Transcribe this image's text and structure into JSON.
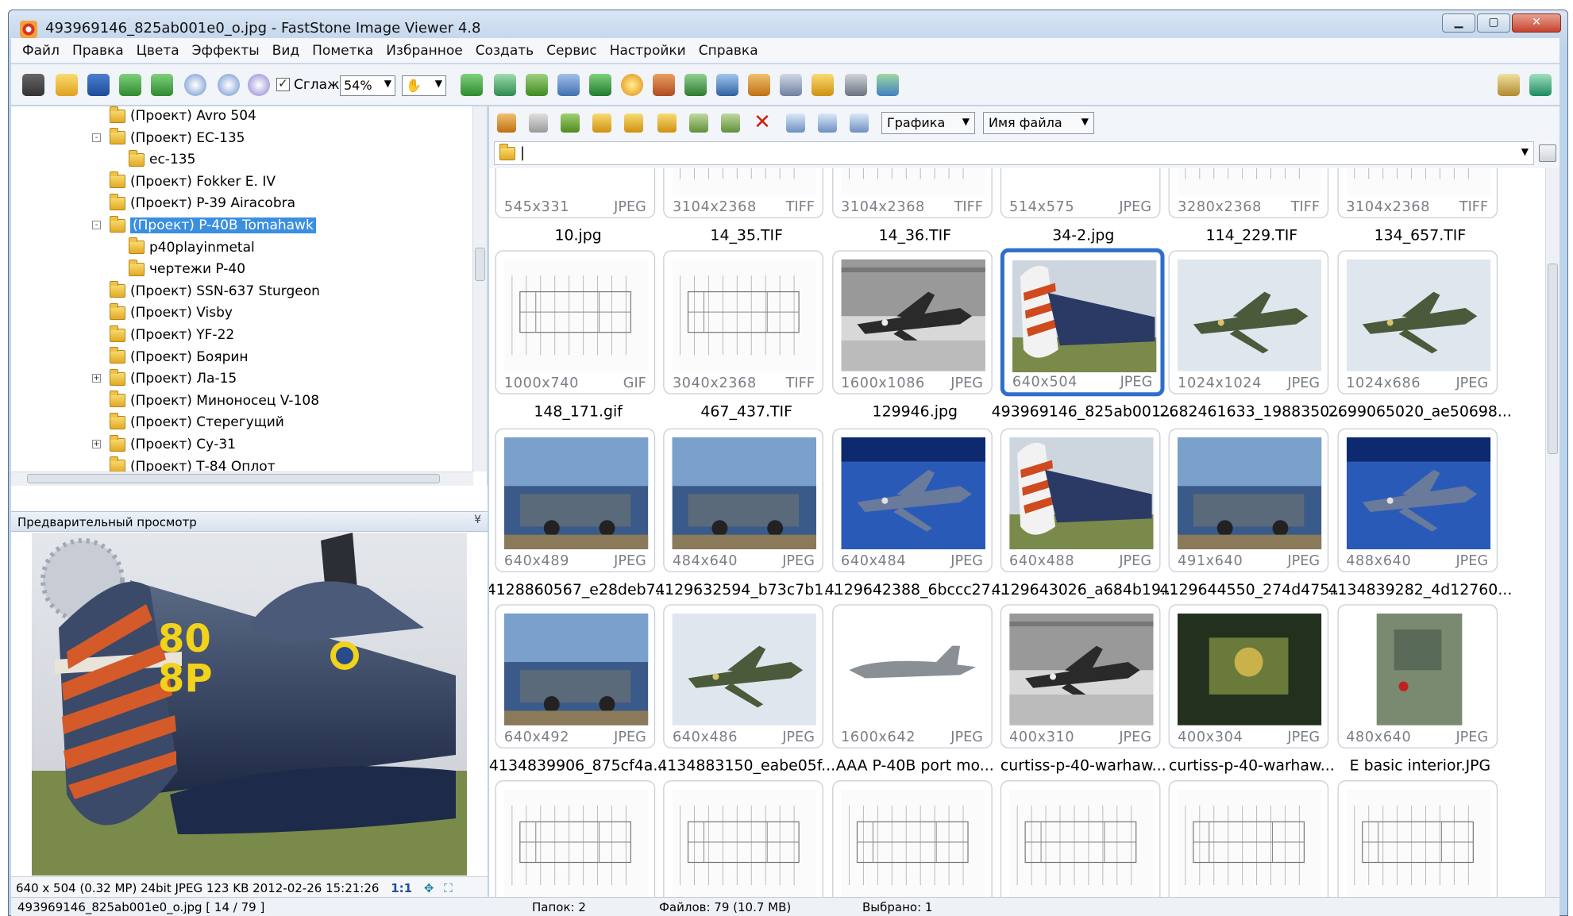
{
  "window": {
    "title": "493969146_825ab001e0_o.jpg  -  FastStone Image Viewer 4.8"
  },
  "menu": [
    "Файл",
    "Правка",
    "Цвета",
    "Эффекты",
    "Вид",
    "Пометка",
    "Избранное",
    "Создать",
    "Сервис",
    "Настройки",
    "Справка"
  ],
  "toolbar": {
    "smooth_label": "Сглаж.",
    "zoom_value": "54%"
  },
  "tree": [
    {
      "label": "(Проект) Avro 504",
      "indent": 0,
      "expander": ""
    },
    {
      "label": "(Проект) EC-135",
      "indent": 0,
      "expander": "-"
    },
    {
      "label": "ec-135",
      "indent": 1,
      "expander": ""
    },
    {
      "label": "(Проект) Fokker E. IV",
      "indent": 0,
      "expander": ""
    },
    {
      "label": "(Проект) P-39 Airacobra",
      "indent": 0,
      "expander": ""
    },
    {
      "label": "(Проект) P-40B Tomahawk",
      "indent": 0,
      "expander": "-",
      "selected": true
    },
    {
      "label": "p40playinmetal",
      "indent": 1,
      "expander": ""
    },
    {
      "label": "чертежи P-40",
      "indent": 1,
      "expander": ""
    },
    {
      "label": "(Проект) SSN-637 Sturgeon",
      "indent": 0,
      "expander": ""
    },
    {
      "label": "(Проект) Visby",
      "indent": 0,
      "expander": ""
    },
    {
      "label": "(Проект) YF-22",
      "indent": 0,
      "expander": ""
    },
    {
      "label": "(Проект) Боярин",
      "indent": 0,
      "expander": ""
    },
    {
      "label": "(Проект) Ла-15",
      "indent": 0,
      "expander": "+"
    },
    {
      "label": "(Проект) Миноносец V-108",
      "indent": 0,
      "expander": ""
    },
    {
      "label": "(Проект) Стерегущий",
      "indent": 0,
      "expander": ""
    },
    {
      "label": "(Проект) Су-31",
      "indent": 0,
      "expander": "+"
    },
    {
      "label": "(Проект) Т-84 Оплот",
      "indent": 0,
      "expander": ""
    }
  ],
  "preview": {
    "header": "Предварительный просмотр",
    "info": "640 x 504 (0.32 MP)  24bit  JPEG   123 KB   2012-02-26 15:21:26",
    "ratio": "1:1"
  },
  "browser": {
    "filter": "Графика",
    "sort": "Имя файла",
    "path": ""
  },
  "thumbs": [
    {
      "name": "10.jpg",
      "dims": "545x331",
      "fmt": "JPEG",
      "kind": "photo-partial"
    },
    {
      "name": "14_35.TIF",
      "dims": "3104x2368",
      "fmt": "TIFF",
      "kind": "drawing-partial"
    },
    {
      "name": "14_36.TIF",
      "dims": "3104x2368",
      "fmt": "TIFF",
      "kind": "drawing-partial"
    },
    {
      "name": "34-2.jpg",
      "dims": "514x575",
      "fmt": "JPEG",
      "kind": "bw-partial"
    },
    {
      "name": "114_229.TIF",
      "dims": "3280x2368",
      "fmt": "TIFF",
      "kind": "drawing-partial"
    },
    {
      "name": "134_657.TIF",
      "dims": "3104x2368",
      "fmt": "TIFF",
      "kind": "drawing-partial"
    },
    {
      "name": "148_171.gif",
      "dims": "1000x740",
      "fmt": "GIF",
      "kind": "drawing"
    },
    {
      "name": "467_437.TIF",
      "dims": "3040x2368",
      "fmt": "TIFF",
      "kind": "drawing"
    },
    {
      "name": "129946.jpg",
      "dims": "1600x1086",
      "fmt": "JPEG",
      "kind": "bw"
    },
    {
      "name": "493969146_825ab001...",
      "dims": "640x504",
      "fmt": "JPEG",
      "kind": "color-tail",
      "selected": true
    },
    {
      "name": "2682461633_1988350...",
      "dims": "1024x1024",
      "fmt": "JPEG",
      "kind": "sky"
    },
    {
      "name": "2699065020_ae50698...",
      "dims": "1024x686",
      "fmt": "JPEG",
      "kind": "sky"
    },
    {
      "name": "4128860567_e28deb7...",
      "dims": "640x489",
      "fmt": "JPEG",
      "kind": "color"
    },
    {
      "name": "4129632594_b73c7b1...",
      "dims": "484x640",
      "fmt": "JPEG",
      "kind": "color"
    },
    {
      "name": "4129642388_6bccc27...",
      "dims": "640x484",
      "fmt": "JPEG",
      "kind": "blue"
    },
    {
      "name": "4129643026_a684b19...",
      "dims": "640x488",
      "fmt": "JPEG",
      "kind": "color-tail"
    },
    {
      "name": "4129644550_274d475...",
      "dims": "491x640",
      "fmt": "JPEG",
      "kind": "color"
    },
    {
      "name": "4134839282_4d12760...",
      "dims": "488x640",
      "fmt": "JPEG",
      "kind": "blue"
    },
    {
      "name": "4134839906_875cf4a...",
      "dims": "640x492",
      "fmt": "JPEG",
      "kind": "color"
    },
    {
      "name": "4134883150_eabe05f...",
      "dims": "640x486",
      "fmt": "JPEG",
      "kind": "sky"
    },
    {
      "name": "AAA P-40B port mo...",
      "dims": "1600x642",
      "fmt": "JPEG",
      "kind": "profile"
    },
    {
      "name": "curtiss-p-40-warhaw...",
      "dims": "400x310",
      "fmt": "JPEG",
      "kind": "bw"
    },
    {
      "name": "curtiss-p-40-warhaw...",
      "dims": "400x304",
      "fmt": "JPEG",
      "kind": "dark"
    },
    {
      "name": "E basic interior.JPG",
      "dims": "480x640",
      "fmt": "JPEG",
      "kind": "interior"
    },
    {
      "name": "",
      "dims": "",
      "fmt": "",
      "kind": "drawing"
    },
    {
      "name": "",
      "dims": "",
      "fmt": "",
      "kind": "drawing"
    },
    {
      "name": "",
      "dims": "",
      "fmt": "",
      "kind": "drawing"
    },
    {
      "name": "",
      "dims": "",
      "fmt": "",
      "kind": "drawing"
    },
    {
      "name": "",
      "dims": "",
      "fmt": "",
      "kind": "drawing"
    },
    {
      "name": "",
      "dims": "",
      "fmt": "",
      "kind": "drawing"
    }
  ],
  "status": {
    "file": "493969146_825ab001e0_o.jpg [ 14 / 79 ]",
    "folders": "Папок: 2",
    "files": "Файлов: 79 (10.7 MB)",
    "selected": "Выбрано: 1"
  },
  "colors": {
    "accent": "#2f6fc9",
    "tree_selected": "#3b8fe0",
    "frame": "#bcd3ec"
  }
}
